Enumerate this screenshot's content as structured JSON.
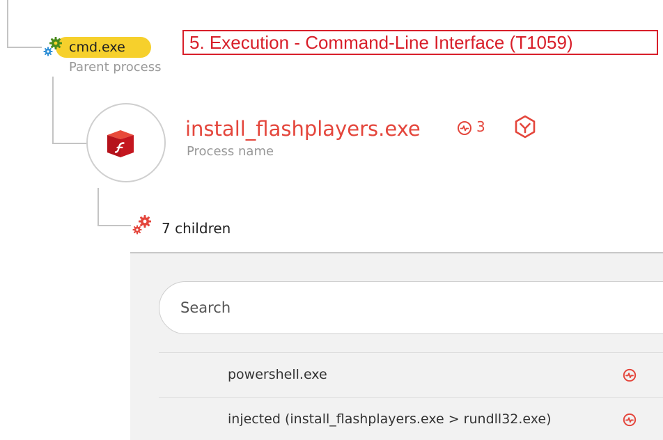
{
  "parent": {
    "name": "cmd.exe",
    "sublabel": "Parent process"
  },
  "technique": {
    "text": "5. Execution - Command-Line Interface (T1059)"
  },
  "process": {
    "name": "install_flashplayers.exe",
    "sublabel": "Process name",
    "alert_count": "3"
  },
  "children": {
    "label": "7 children",
    "search": {
      "placeholder": "Search"
    },
    "items": [
      {
        "label": "powershell.exe"
      },
      {
        "label": "injected (install_flashplayers.exe > rundll32.exe)"
      }
    ]
  },
  "icons": {
    "parent": "gears-icon",
    "process": "flash-box-icon",
    "alert": "alert-circle-icon",
    "shield": "hexagon-shield-icon",
    "children": "gears-icon"
  },
  "colors": {
    "accent": "#e4463c",
    "highlight": "#f6d02c",
    "annotation": "#d81f2a"
  }
}
